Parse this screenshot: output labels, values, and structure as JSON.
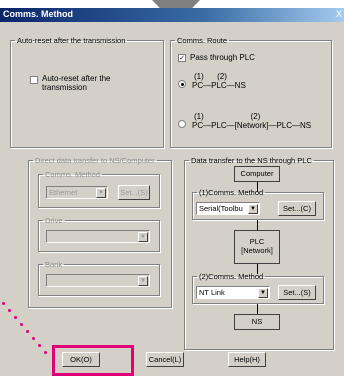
{
  "window": {
    "title": "Comms. Method",
    "close": "X"
  },
  "auto_reset": {
    "legend": "Auto-reset after the transmission",
    "checkbox_label": "Auto-reset after the transmission",
    "checked": false
  },
  "route": {
    "legend": "Comms. Route",
    "pass_through_label": "Pass through PLC",
    "pass_through_checked": true,
    "option1_numbers": "(1)      (2)",
    "option1_path": "PC—PLC—NS",
    "option2_numbers": "(1)                     (2)",
    "option2_path": "PC—PLC—[Network]—PLC—NS"
  },
  "direct": {
    "legend": "Direct data transfer to NS/Computer",
    "comms_legend": "Comms. Method",
    "comms_value": "Ethernet",
    "set_label": "Set...(S)",
    "drive_legend": "Drive",
    "bank_legend": "Bank"
  },
  "through_plc": {
    "legend": "Data transfer to the NS through PLC",
    "computer_label": "Computer",
    "comms1_legend": "(1)Comms. Method",
    "comms1_value": "Serial(Toolbu",
    "set1_label": "Set...(C)",
    "plc_label": "PLC",
    "network_label": "[Network]",
    "comms2_legend": "(2)Comms. Method",
    "comms2_value": "NT Link",
    "set2_label": "Set...(S)",
    "ns_label": "NS"
  },
  "footer": {
    "ok_label": "OK(O)",
    "cancel_label": "Cancel(L)",
    "help_label": "Help(H)"
  },
  "colors": {
    "highlight": "#e0007a",
    "titlebar": "#0a246a"
  }
}
